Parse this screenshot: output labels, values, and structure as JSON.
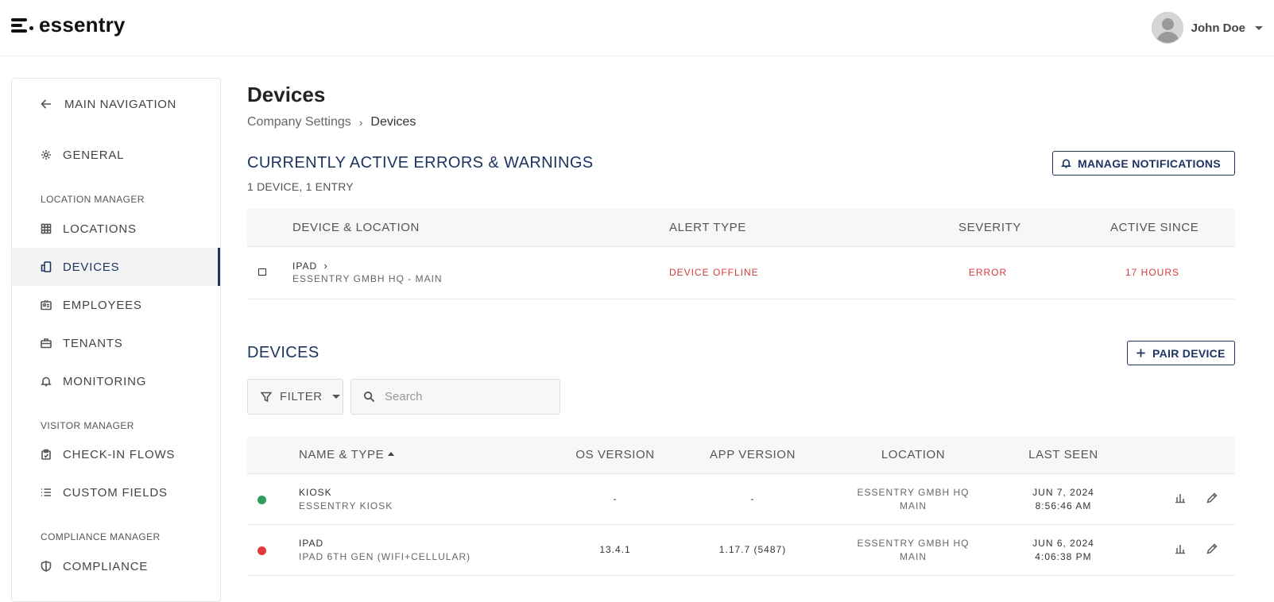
{
  "app": {
    "logo_text": "essentry"
  },
  "user": {
    "name": "John Doe"
  },
  "sidebar": {
    "back_label": "MAIN NAVIGATION",
    "general_label": "GENERAL",
    "sections": {
      "location_manager": "LOCATION MANAGER",
      "visitor_manager": "VISITOR MANAGER",
      "compliance_manager": "COMPLIANCE MANAGER"
    },
    "items": {
      "locations": "LOCATIONS",
      "devices": "DEVICES",
      "employees": "EMPLOYEES",
      "tenants": "TENANTS",
      "monitoring": "MONITORING",
      "checkin_flows": "CHECK-IN FLOWS",
      "custom_fields": "CUSTOM FIELDS",
      "compliance": "COMPLIANCE"
    },
    "active_item": "devices"
  },
  "page": {
    "title": "Devices",
    "breadcrumb": {
      "parent": "Company Settings",
      "current": "Devices"
    }
  },
  "alerts": {
    "title": "CURRENTLY ACTIVE ERRORS & WARNINGS",
    "subtitle": "1 DEVICE, 1 ENTRY",
    "manage_button": "MANAGE NOTIFICATIONS",
    "columns": {
      "device_location": "DEVICE & LOCATION",
      "alert_type": "ALERT TYPE",
      "severity": "SEVERITY",
      "active_since": "ACTIVE SINCE"
    },
    "rows": [
      {
        "device": "IPAD",
        "location": "ESSENTRY GMBH HQ - MAIN",
        "alert_type": "DEVICE OFFLINE",
        "severity": "ERROR",
        "active_since": "17 HOURS"
      }
    ]
  },
  "devices": {
    "title": "DEVICES",
    "pair_button": "PAIR DEVICE",
    "filter_label": "FILTER",
    "search_placeholder": "Search",
    "columns": {
      "name_type": "NAME & TYPE",
      "os_version": "OS VERSION",
      "app_version": "APP VERSION",
      "location": "LOCATION",
      "last_seen": "LAST SEEN"
    },
    "rows": [
      {
        "status_color": "#2e9e5b",
        "name": "KIOSK",
        "type": "ESSENTRY KIOSK",
        "os_version": "-",
        "app_version": "-",
        "location_line1": "ESSENTRY GMBH HQ",
        "location_line2": "MAIN",
        "last_seen_date": "JUN 7, 2024",
        "last_seen_time": "8:56:46 AM"
      },
      {
        "status_color": "#e0383e",
        "name": "IPAD",
        "type": "IPAD 6TH GEN (WIFI+CELLULAR)",
        "os_version": "13.4.1",
        "app_version": "1.17.7 (5487)",
        "location_line1": "ESSENTRY GMBH HQ",
        "location_line2": "MAIN",
        "last_seen_date": "JUN 6, 2024",
        "last_seen_time": "4:06:38 PM"
      }
    ]
  },
  "colors": {
    "accent": "#1d3461",
    "error": "#d63a3a",
    "online": "#2e9e5b",
    "offline": "#e0383e"
  }
}
